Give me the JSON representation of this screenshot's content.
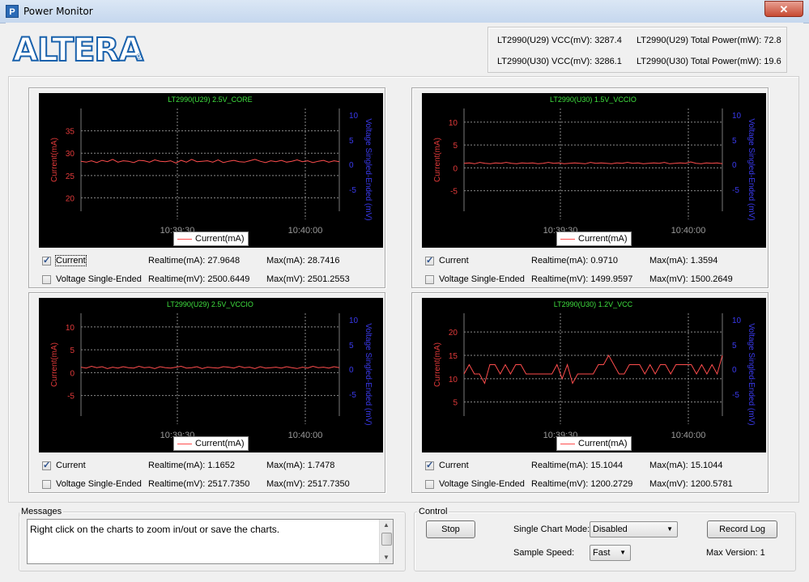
{
  "window": {
    "title": "Power Monitor",
    "close_glyph": "✕",
    "app_icon_glyph": "P"
  },
  "logo": {
    "text": "ALTERA",
    "reg": "®"
  },
  "summary": {
    "u29_vcc": "LT2990(U29) VCC(mV): 3287.4",
    "u29_power": "LT2990(U29) Total Power(mW):  72.8",
    "u30_vcc": "LT2990(U30) VCC(mV): 3286.1",
    "u30_power": "LT2990(U30) Total Power(mW):  19.6"
  },
  "panels": [
    {
      "chart_data": {
        "type": "line",
        "title": "LT2990(U29) 2.5V_CORE",
        "ylabel": "Current(mA)",
        "y2label": "Voltage Singled-Ended (mV)",
        "ylim": [
          17,
          40
        ],
        "yticks": [
          20,
          25,
          30,
          35
        ],
        "y2ticks": [
          "10",
          "5",
          "0",
          "-5"
        ],
        "xticks": [
          "10:39:30",
          "10:40:00"
        ],
        "legend": "Current(mA)",
        "series": [
          {
            "name": "Current(mA)",
            "color": "#ff4d4d",
            "values": [
              28.2,
              28.0,
              28.3,
              27.9,
              28.4,
              28.1,
              28.6,
              28.0,
              28.3,
              28.2,
              27.9,
              28.4,
              28.3,
              28.0,
              28.5,
              28.2,
              28.1,
              28.3,
              27.8,
              28.4,
              28.0,
              28.6,
              28.1,
              28.2,
              28.3,
              28.0,
              28.5,
              27.9,
              28.2,
              28.4,
              28.1,
              28.0,
              28.3,
              28.6,
              28.2,
              27.9,
              28.3,
              28.1,
              28.4,
              28.0,
              28.2,
              28.5,
              28.1,
              28.3,
              27.9,
              28.2,
              28.4,
              28.0,
              28.3,
              28.1
            ]
          }
        ]
      },
      "current": {
        "label": "Current",
        "checked": true,
        "realtime": "Realtime(mA): 27.9648",
        "max": "Max(mA): 28.7416"
      },
      "voltage": {
        "label": "Voltage Single-Ended",
        "checked": false,
        "realtime": "Realtime(mV): 2500.6449",
        "max": "Max(mV): 2501.2553"
      }
    },
    {
      "chart_data": {
        "type": "line",
        "title": "LT2990(U30) 1.5V_VCCIO",
        "ylabel": "Current(mA)",
        "y2label": "Voltage Singled-Ended (mV)",
        "ylim": [
          -9.5,
          13
        ],
        "yticks": [
          -5,
          0,
          5,
          10
        ],
        "y2ticks": [
          "10",
          "5",
          "0",
          "-5"
        ],
        "xticks": [
          "10:39:30",
          "10:40:00"
        ],
        "legend": "Current(mA)",
        "series": [
          {
            "name": "Current(mA)",
            "color": "#ff4d4d",
            "values": [
              1.0,
              1.1,
              0.9,
              1.2,
              1.0,
              0.9,
              1.1,
              1.0,
              1.2,
              1.0,
              0.9,
              1.1,
              1.0,
              1.1,
              0.9,
              1.0,
              1.2,
              1.0,
              1.1,
              0.9,
              1.0,
              1.1,
              1.0,
              0.9,
              1.2,
              1.0,
              1.1,
              1.0,
              0.9,
              1.1,
              1.0,
              1.2,
              1.0,
              1.1,
              0.9,
              1.0,
              1.1,
              1.0,
              1.2,
              0.9,
              1.0,
              1.1,
              1.0,
              1.3,
              1.0,
              0.9,
              1.1,
              1.0,
              1.1,
              0.9
            ]
          }
        ]
      },
      "current": {
        "label": "Current",
        "checked": true,
        "realtime": "Realtime(mA): 0.9710",
        "max": "Max(mA): 1.3594"
      },
      "voltage": {
        "label": "Voltage Single-Ended",
        "checked": false,
        "realtime": "Realtime(mV): 1499.9597",
        "max": "Max(mV): 1500.2649"
      }
    },
    {
      "chart_data": {
        "type": "line",
        "title": "LT2990(U29) 2.5V_VCCIO",
        "ylabel": "Current(mA)",
        "y2label": "Voltage Singled-Ended (mV)",
        "ylim": [
          -9.5,
          13
        ],
        "yticks": [
          -5,
          0,
          5,
          10
        ],
        "y2ticks": [
          "10",
          "5",
          "0",
          "-5"
        ],
        "xticks": [
          "10:39:30",
          "10:40:00"
        ],
        "legend": "Current(mA)",
        "series": [
          {
            "name": "Current(mA)",
            "color": "#ff4d4d",
            "values": [
              1.2,
              1.0,
              1.4,
              1.1,
              1.3,
              0.9,
              1.2,
              1.0,
              1.3,
              1.1,
              1.0,
              1.4,
              1.1,
              1.2,
              0.9,
              1.3,
              1.1,
              1.0,
              1.2,
              1.4,
              1.0,
              1.1,
              1.3,
              0.9,
              1.2,
              1.1,
              1.0,
              1.3,
              1.2,
              1.0,
              1.4,
              1.1,
              1.2,
              0.9,
              1.3,
              1.0,
              1.1,
              1.2,
              1.0,
              1.3,
              1.1,
              0.9,
              1.2,
              1.0,
              1.4,
              1.1,
              1.2,
              1.0,
              1.3,
              1.1
            ]
          }
        ]
      },
      "current": {
        "label": "Current",
        "checked": true,
        "realtime": "Realtime(mA): 1.1652",
        "max": "Max(mA): 1.7478"
      },
      "voltage": {
        "label": "Voltage Single-Ended",
        "checked": false,
        "realtime": "Realtime(mV): 2517.7350",
        "max": "Max(mV): 2517.7350"
      }
    },
    {
      "chart_data": {
        "type": "line",
        "title": "LT2990(U30) 1.2V_VCC",
        "ylabel": "Current(mA)",
        "y2label": "Voltage Singled-Ended (mV)",
        "ylim": [
          2,
          24
        ],
        "yticks": [
          5,
          10,
          15,
          20
        ],
        "y2ticks": [
          "10",
          "5",
          "0",
          "-5"
        ],
        "xticks": [
          "10:39:30",
          "10:40:00"
        ],
        "legend": "Current(mA)",
        "series": [
          {
            "name": "Current(mA)",
            "color": "#ff4d4d",
            "values": [
              11,
              13,
              11,
              11,
              9,
              13,
              13,
              11,
              13,
              11,
              13,
              13,
              11,
              11,
              11,
              11,
              11,
              11,
              13,
              10,
              13,
              9,
              11,
              11,
              11,
              11,
              13,
              13,
              15,
              13,
              11,
              11,
              13,
              13,
              13,
              11,
              13,
              11,
              13,
              13,
              11,
              13,
              13,
              13,
              13,
              11,
              13,
              11,
              13,
              11,
              15
            ]
          }
        ]
      },
      "current": {
        "label": "Current",
        "checked": true,
        "realtime": "Realtime(mA): 15.1044",
        "max": "Max(mA): 15.1044"
      },
      "voltage": {
        "label": "Voltage Single-Ended",
        "checked": false,
        "realtime": "Realtime(mV): 1200.2729",
        "max": "Max(mV): 1200.5781"
      }
    }
  ],
  "messages": {
    "title": "Messages",
    "text": "Right click on the charts to zoom in/out or save the charts.",
    "up": "▲",
    "down": "▼"
  },
  "control": {
    "title": "Control",
    "stop": "Stop",
    "single_chart_label": "Single Chart Mode:",
    "single_chart_value": "Disabled",
    "sample_speed_label": "Sample Speed:",
    "sample_speed_value": "Fast",
    "record_log": "Record Log",
    "max_version": "Max Version: 1",
    "arrow": "▼"
  }
}
